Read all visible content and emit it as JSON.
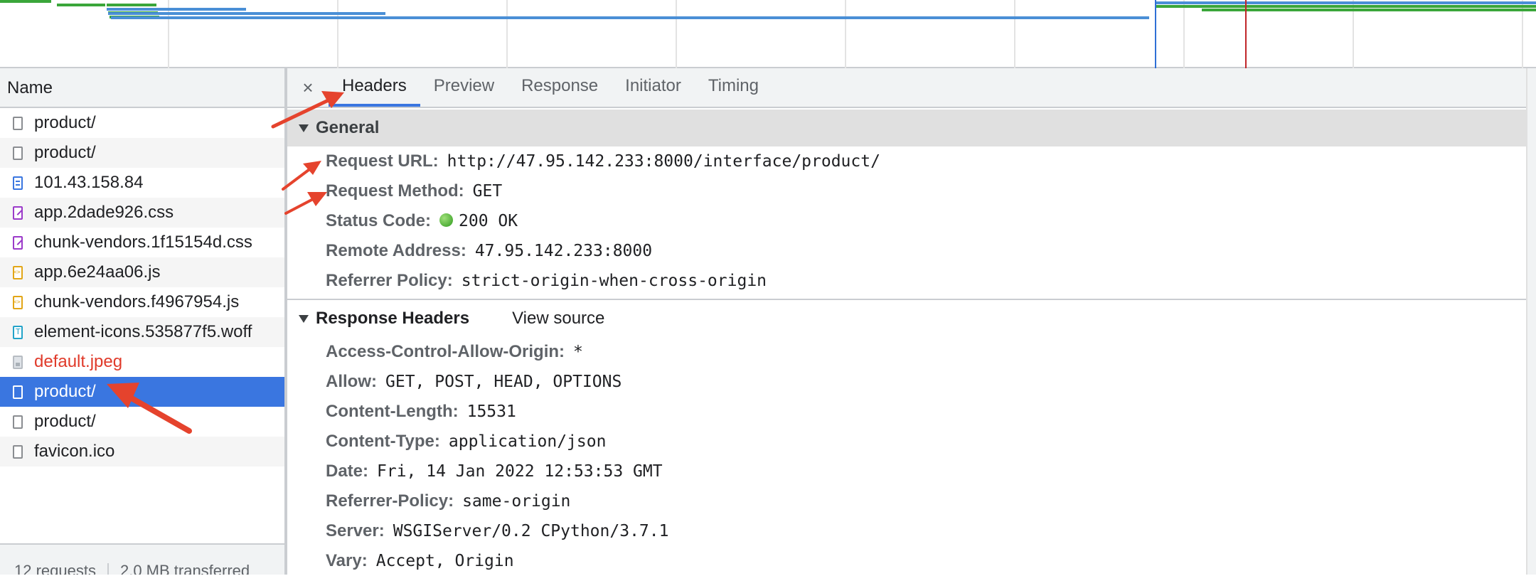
{
  "request_list": {
    "column_name": "Name",
    "rows": [
      {
        "label": "product/",
        "icon": "document-icon"
      },
      {
        "label": "product/",
        "icon": "document-icon"
      },
      {
        "label": "101.43.158.84",
        "icon": "html-doc-icon"
      },
      {
        "label": "app.2dade926.css",
        "icon": "stylesheet-icon"
      },
      {
        "label": "chunk-vendors.1f15154d.css",
        "icon": "stylesheet-icon"
      },
      {
        "label": "app.6e24aa06.js",
        "icon": "script-icon"
      },
      {
        "label": "chunk-vendors.f4967954.js",
        "icon": "script-icon"
      },
      {
        "label": "element-icons.535877f5.woff",
        "icon": "font-icon"
      },
      {
        "label": "default.jpeg",
        "icon": "image-icon",
        "status": "error"
      },
      {
        "label": "product/",
        "icon": "document-icon",
        "selected": true
      },
      {
        "label": "product/",
        "icon": "document-icon"
      },
      {
        "label": "favicon.ico",
        "icon": "document-icon"
      }
    ],
    "status_bar": {
      "requests": "12 requests",
      "transferred": "2.0 MB transferred"
    }
  },
  "details": {
    "close_label": "×",
    "tabs": [
      {
        "label": "Headers",
        "active": true
      },
      {
        "label": "Preview"
      },
      {
        "label": "Response"
      },
      {
        "label": "Initiator"
      },
      {
        "label": "Timing"
      }
    ],
    "general": {
      "title": "General",
      "items": [
        {
          "key": "Request URL:",
          "value": "http://47.95.142.233:8000/interface/product/"
        },
        {
          "key": "Request Method:",
          "value": "GET"
        },
        {
          "key": "Status Code:",
          "value": "200 OK"
        },
        {
          "key": "Remote Address:",
          "value": "47.95.142.233:8000"
        },
        {
          "key": "Referrer Policy:",
          "value": "strict-origin-when-cross-origin"
        }
      ]
    },
    "response_headers": {
      "title": "Response Headers",
      "view_source": "View source",
      "items": [
        {
          "key": "Access-Control-Allow-Origin:",
          "value": "*"
        },
        {
          "key": "Allow:",
          "value": "GET, POST, HEAD, OPTIONS"
        },
        {
          "key": "Content-Length:",
          "value": "15531"
        },
        {
          "key": "Content-Type:",
          "value": "application/json"
        },
        {
          "key": "Date:",
          "value": "Fri, 14 Jan 2022 12:53:53 GMT"
        },
        {
          "key": "Referrer-Policy:",
          "value": "same-origin"
        },
        {
          "key": "Server:",
          "value": "WSGIServer/0.2 CPython/3.7.1"
        },
        {
          "key": "Vary:",
          "value": "Accept, Origin"
        }
      ]
    }
  },
  "colors": {
    "selected_row": "#3a76e0",
    "error_text": "#e03a2a",
    "annotation_arrow": "#e5432d",
    "status_ok": "#2f9a1d"
  }
}
